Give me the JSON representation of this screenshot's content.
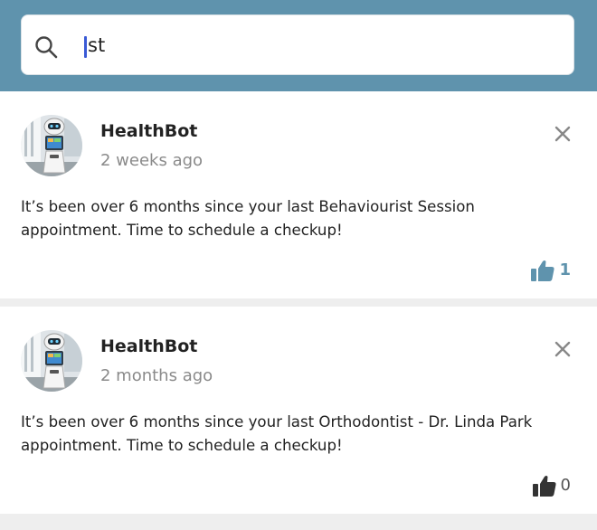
{
  "colors": {
    "header": "#5f93ad",
    "caret": "#3a5ad6",
    "like_active": "#5f93ad",
    "like_inactive": "#333333"
  },
  "search": {
    "value": "st",
    "icon": "search-icon"
  },
  "notifications": [
    {
      "author": "HealthBot",
      "time": "2 weeks ago",
      "message": "It’s been over 6 months since your last Behaviourist Session appointment. Time to schedule a checkup!",
      "likes": "1",
      "liked": true,
      "icons": {
        "avatar": "robot-avatar",
        "close": "close-icon",
        "like": "thumbs-up-icon"
      }
    },
    {
      "author": "HealthBot",
      "time": "2 months ago",
      "message": "It’s been over 6 months since your last Orthodontist - Dr. Linda Park appointment. Time to schedule a checkup!",
      "likes": "0",
      "liked": false,
      "icons": {
        "avatar": "robot-avatar",
        "close": "close-icon",
        "like": "thumbs-up-icon"
      }
    }
  ]
}
